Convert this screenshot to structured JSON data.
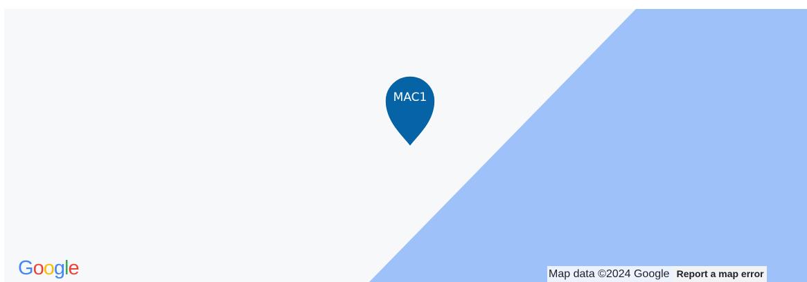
{
  "map": {
    "land_color": "#f7f8fa",
    "water_color": "#9fc1fa"
  },
  "marker": {
    "label": "MAC1",
    "color": "#0563a6"
  },
  "logo": {
    "letters": [
      {
        "char": "G",
        "color": "#4285f4"
      },
      {
        "char": "o",
        "color": "#ea4335"
      },
      {
        "char": "o",
        "color": "#fbbc05"
      },
      {
        "char": "g",
        "color": "#4285f4"
      },
      {
        "char": "l",
        "color": "#34a853"
      },
      {
        "char": "e",
        "color": "#ea4335"
      }
    ]
  },
  "attribution": {
    "map_data": "Map data ©2024 Google",
    "report_error": "Report a map error"
  }
}
